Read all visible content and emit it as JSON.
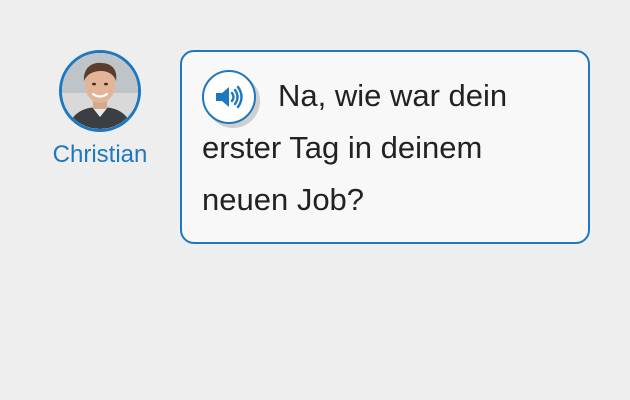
{
  "speaker": {
    "name": "Christian",
    "avatar_icon": "person-photo"
  },
  "bubble": {
    "audio_icon": "speaker-volume-icon",
    "message": "Na, wie war dein erster Tag in deinem neuen Job?"
  },
  "colors": {
    "accent": "#1f78bf",
    "background": "#eeeeee",
    "bubble_background": "#f8f8f8",
    "text": "#222222"
  }
}
